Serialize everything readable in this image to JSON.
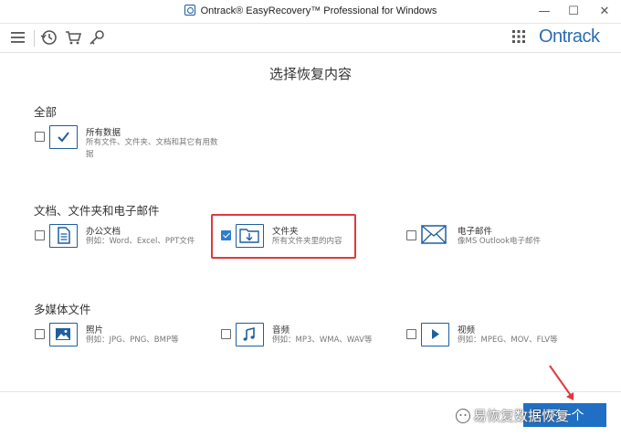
{
  "window": {
    "title": "Ontrack® EasyRecovery™ Professional for Windows",
    "controls": {
      "minimize": "—",
      "maximize": "☐",
      "close": "✕"
    }
  },
  "toolbar": {
    "icons": [
      "menu-icon",
      "history-icon",
      "cart-icon",
      "key-icon",
      "apps-grid-icon"
    ],
    "brand": "Ontrack",
    "brand_color": "#2a6db0"
  },
  "main": {
    "title": "选择恢复内容",
    "sections": [
      {
        "title": "全部",
        "items": [
          {
            "name": "所有数据",
            "desc": "所有文件、文件夹、文档和其它有用数据",
            "checked": false,
            "icon": "check-icon"
          }
        ]
      },
      {
        "title": "文档、文件夹和电子邮件",
        "items": [
          {
            "name": "办公文档",
            "desc": "例如：Word、Excel、PPT文件",
            "checked": false,
            "icon": "document-icon"
          },
          {
            "name": "文件夹",
            "desc": "所有文件夹里的内容",
            "checked": true,
            "icon": "folder-download-icon"
          },
          {
            "name": "电子邮件",
            "desc": "像MS Outlook电子邮件",
            "checked": false,
            "icon": "mail-icon"
          }
        ]
      },
      {
        "title": "多媒体文件",
        "items": [
          {
            "name": "照片",
            "desc": "例如：JPG、PNG、BMP等",
            "checked": false,
            "icon": "image-icon"
          },
          {
            "name": "音频",
            "desc": "例如：MP3、WMA、WAV等",
            "checked": false,
            "icon": "music-note-icon"
          },
          {
            "name": "视频",
            "desc": "例如：MPEG、MOV、FLV等",
            "checked": false,
            "icon": "play-icon"
          }
        ]
      }
    ]
  },
  "footer": {
    "next_button": "下一个",
    "watermark": "易恢复数据恢复",
    "accent_color": "#1f6fc4",
    "highlight_color": "#e0393e"
  }
}
